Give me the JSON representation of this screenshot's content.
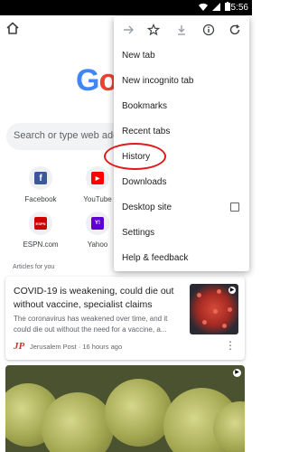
{
  "status_bar": {
    "time": "5:56",
    "icons": [
      "wifi-icon",
      "signal-icon",
      "battery-icon"
    ]
  },
  "toolbar": {
    "home_icon": "home-icon"
  },
  "logo": {
    "text_blue": "G",
    "text_red": "o"
  },
  "search": {
    "placeholder": "Search or type web address"
  },
  "tiles": [
    {
      "label": "Facebook",
      "icon": "facebook-icon",
      "glyph": "f",
      "color": "#3b5998"
    },
    {
      "label": "YouTube",
      "icon": "youtube-icon",
      "glyph": "▶",
      "color": "#ff0000"
    },
    {
      "label": "ESPN.com",
      "icon": "espn-icon",
      "glyph": "ESPN",
      "color": "#d00000"
    },
    {
      "label": "Yahoo",
      "icon": "yahoo-icon",
      "glyph": "Y!",
      "color": "#5f01d1"
    }
  ],
  "articles": {
    "header": "Articles for you",
    "card": {
      "title": "COVID-19 is weakening, could die out without vaccine, specialist claims",
      "snippet": "The coronavirus has weakened over time, and it could die out without the need for a vaccine, a...",
      "source_logo": "JP",
      "source": "Jerusalem Post · 16 hours ago"
    }
  },
  "menu": {
    "icons": [
      "forward-icon",
      "star-icon",
      "download-icon",
      "info-icon",
      "refresh-icon"
    ],
    "items": [
      "New tab",
      "New incognito tab",
      "Bookmarks",
      "Recent tabs",
      "History",
      "Downloads",
      "Desktop site",
      "Settings",
      "Help & feedback"
    ],
    "desktop_site_checked": false
  },
  "colors": {
    "accent_red": "#e0191b",
    "google_blue": "#4285f4",
    "google_red": "#ea4335"
  }
}
